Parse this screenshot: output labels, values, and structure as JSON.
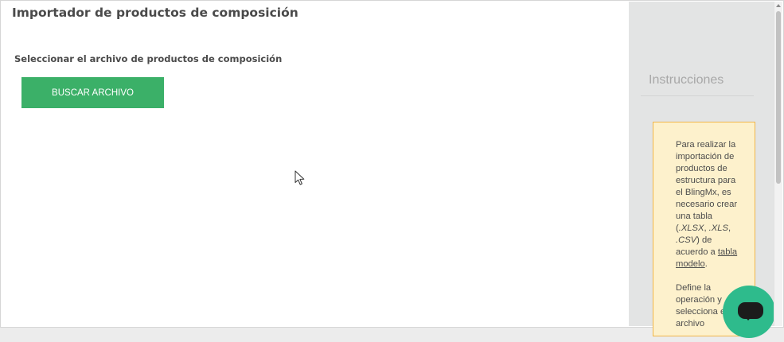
{
  "main": {
    "title": "Importador de productos de composición",
    "file_label": "Seleccionar el archivo de productos de composición",
    "browse_button": "BUSCAR ARCHIVO"
  },
  "sidebar": {
    "title": "Instrucciones",
    "note": {
      "p1_before": "Para realizar la importación de productos de estructura para el BlingMx, es necesario crear una tabla (",
      "fmt1": ".XLSX",
      "sep1": ", ",
      "fmt2": ".XLS",
      "sep2": ", ",
      "fmt3": ".CSV",
      "p1_after": ") de acuerdo a ",
      "link": "tabla modelo",
      "p1_end": ".",
      "p2": "Define la operación y selecciona el archivo"
    }
  },
  "chat": {
    "icon": "chat-bubble-icon"
  },
  "colors": {
    "accent": "#3bb068",
    "note_bg": "#fdf1cc",
    "note_border": "#f0b54a",
    "sidebar_bg": "#e3e4e4",
    "chat": "#2ebb8c"
  }
}
